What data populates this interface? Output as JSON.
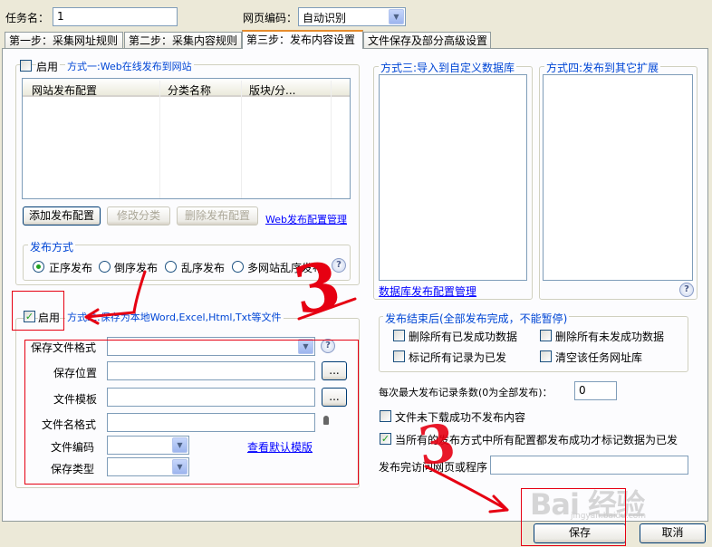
{
  "task": {
    "label": "任务名：",
    "value": "1"
  },
  "encoding": {
    "label": "网页编码：",
    "value": "自动识别"
  },
  "tabs": [
    {
      "label": "第一步：采集网址规则"
    },
    {
      "label": "第二步：采集内容规则"
    },
    {
      "label": "第三步：发布内容设置"
    },
    {
      "label": "文件保存及部分高级设置"
    }
  ],
  "method1": {
    "enable_label": "启用",
    "title": "方式一:Web在线发布到网站",
    "columns": [
      "网站发布配置",
      "分类名称",
      "版块/分..."
    ],
    "buttons": {
      "add": "添加发布配置",
      "edit": "修改分类",
      "delete": "删除发布配置"
    },
    "manage_link": "Web发布配置管理"
  },
  "publish_mode": {
    "title": "发布方式",
    "options": [
      "正序发布",
      "倒序发布",
      "乱序发布",
      "多网站乱序发布"
    ],
    "selected": "正序发布"
  },
  "method2": {
    "enable_label": "启用",
    "title_visible": "方式二:保存为本地Word,Excel,Html,Txt等文件",
    "fields": {
      "format": "保存文件格式",
      "location": "保存位置",
      "template": "文件模板",
      "filename": "文件名格式",
      "encoding": "文件编码",
      "type": "保存类型"
    },
    "browse": "...",
    "default_template_link": "查看默认模版"
  },
  "method3": {
    "title": "方式三:导入到自定义数据库",
    "link": "数据库发布配置管理"
  },
  "method4": {
    "title": "方式四:发布到其它扩展"
  },
  "after_publish": {
    "title": "发布结束后(全部发布完成，不能暂停)",
    "options": [
      "删除所有已发成功数据",
      "删除所有未发成功数据",
      "标记所有记录为已发",
      "清空该任务网址库"
    ]
  },
  "max_records": {
    "label": "每次最大发布记录条数(0为全部发布)：",
    "value": "0"
  },
  "options": {
    "skip_undownloaded": "文件未下载成功不发布内容",
    "mark_when_all": "当所有的发布方式中所有配置都发布成功才标记数据为已发"
  },
  "after_url": {
    "label": "发布完访问网页或程序",
    "value": ""
  },
  "footer": {
    "save": "保存",
    "cancel": "取消"
  },
  "watermark": {
    "text": "Bai 经验",
    "sub": "jingyan.baidu.com"
  },
  "annotations": {
    "number": "3"
  },
  "colors": {
    "annotation_red": "#e60012",
    "group_title": "#0046d5",
    "link": "#0000ff"
  }
}
